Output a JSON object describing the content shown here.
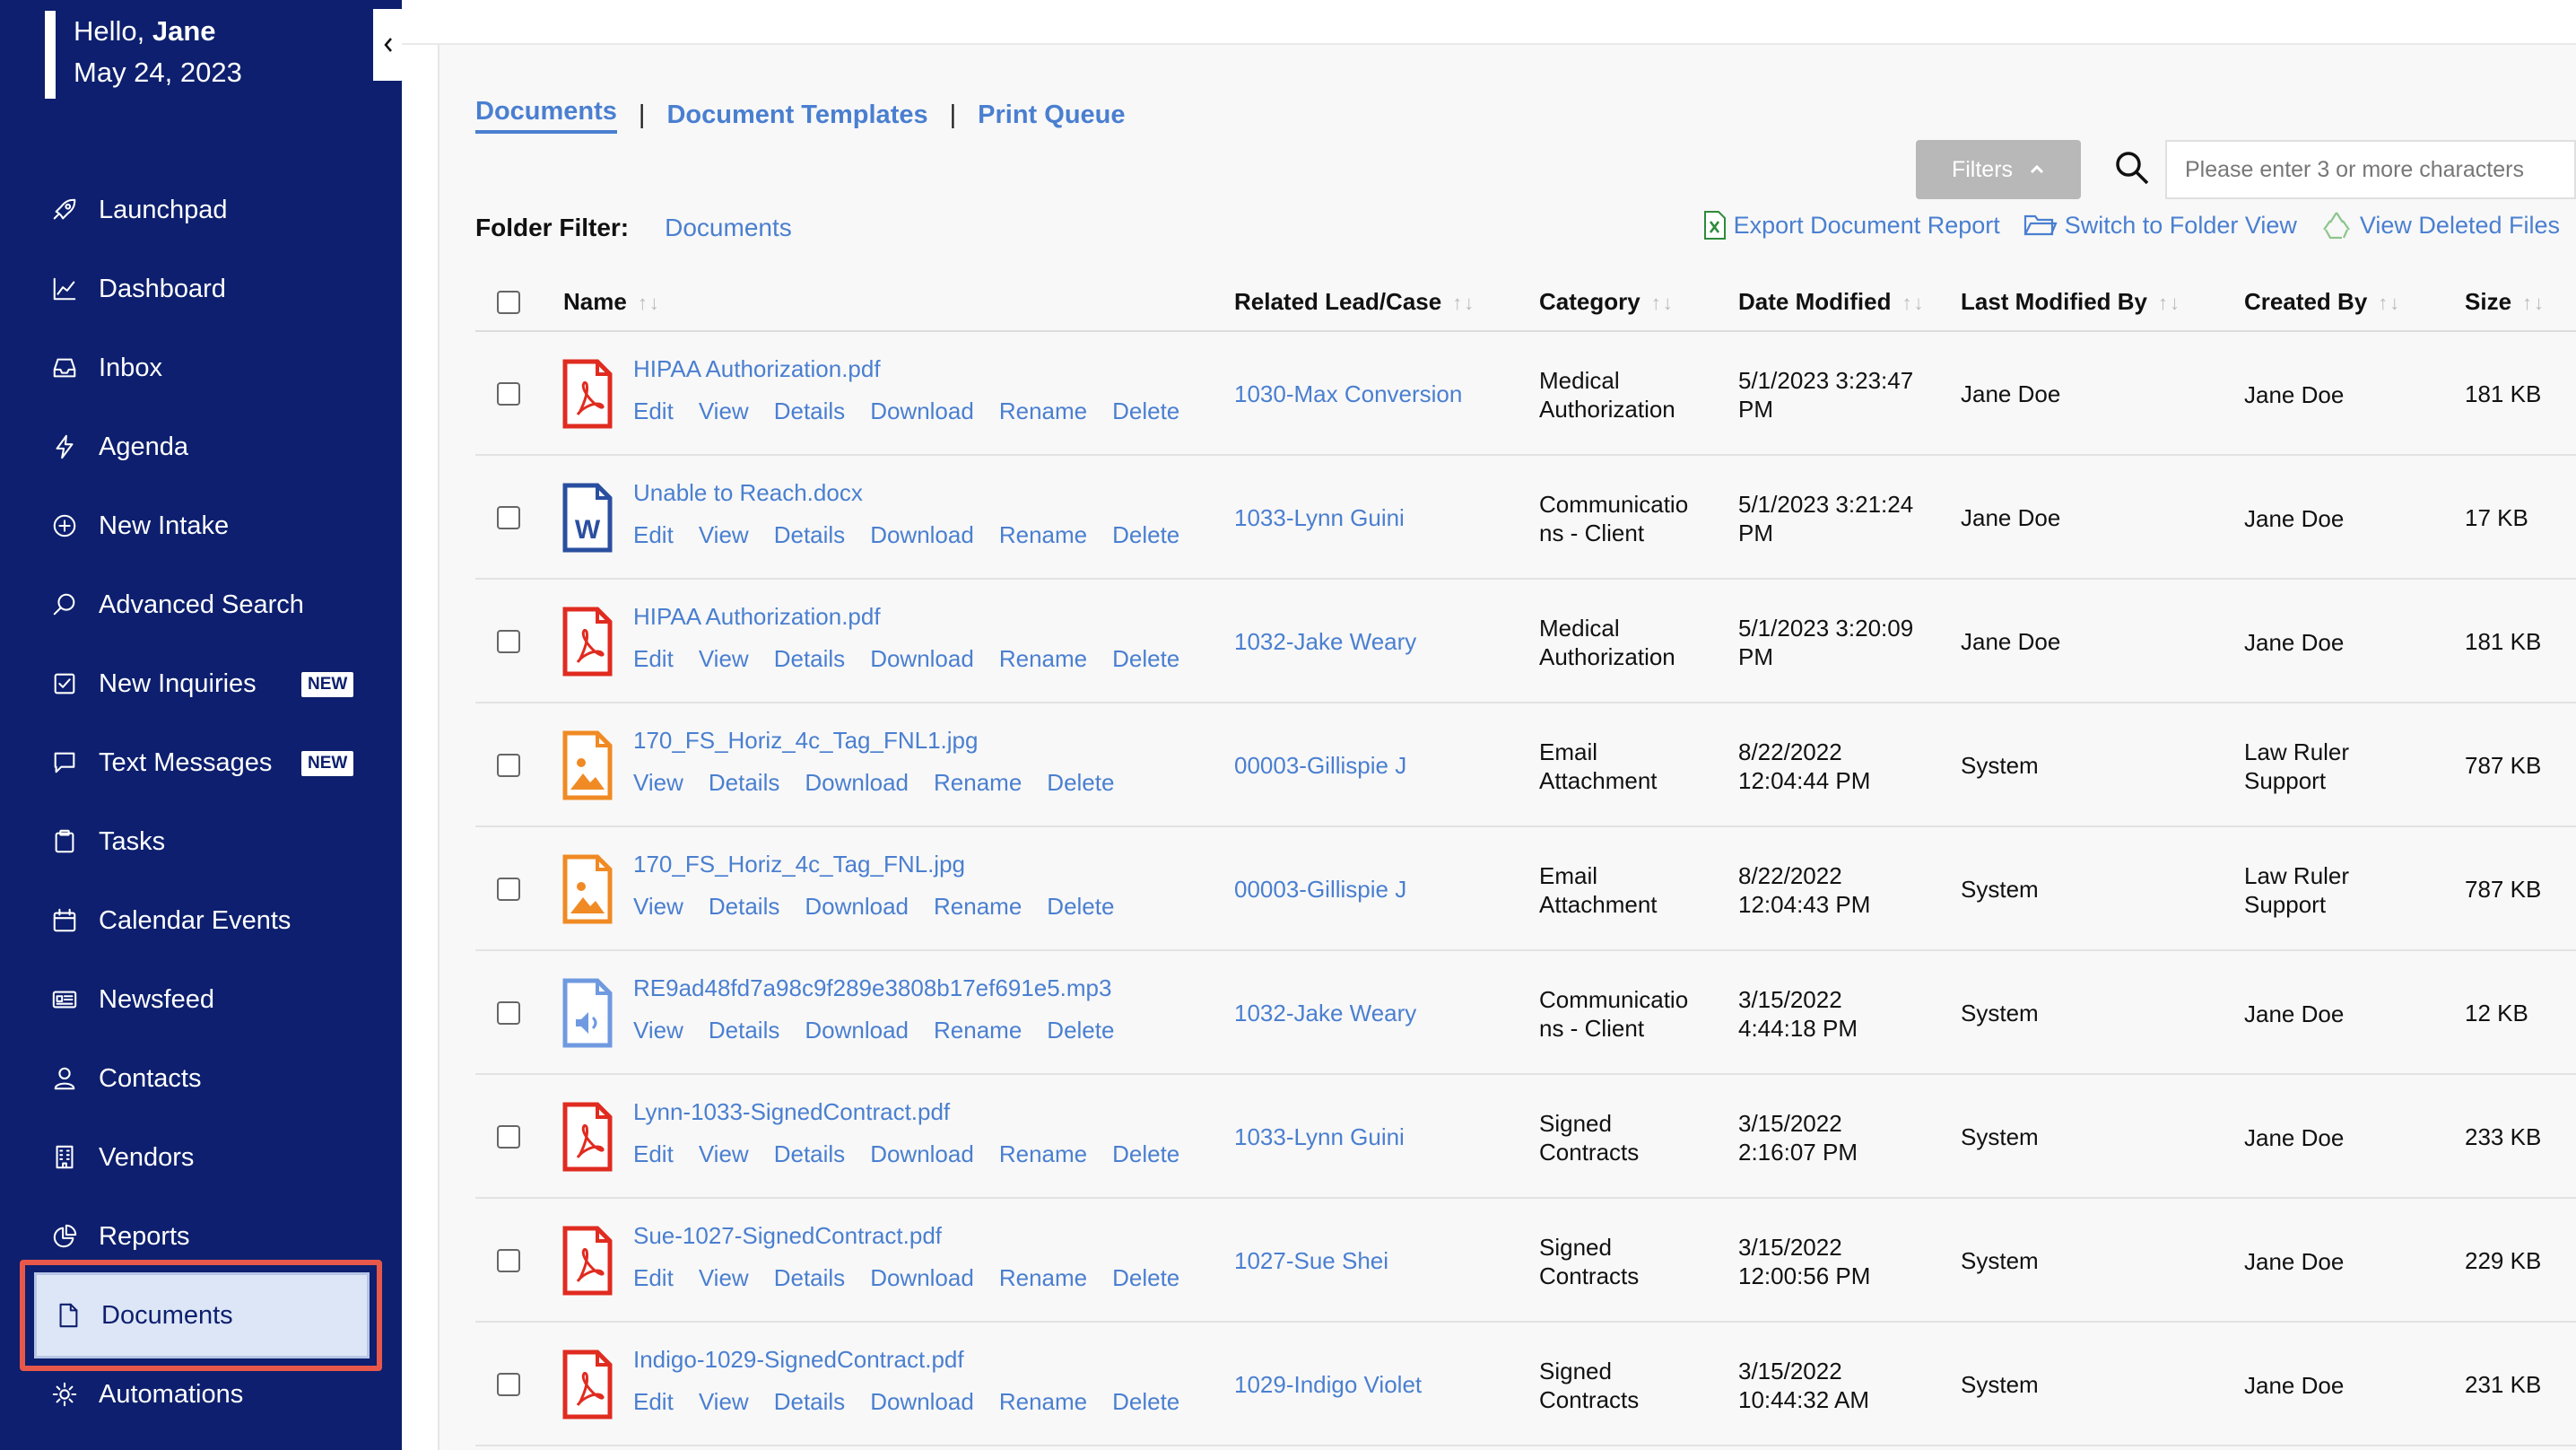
{
  "greeting": {
    "hello": "Hello,",
    "name": "Jane",
    "date": "May 24, 2023"
  },
  "sidebar": {
    "items": [
      {
        "label": "Launchpad",
        "icon": "rocket-icon"
      },
      {
        "label": "Dashboard",
        "icon": "chart-line-icon"
      },
      {
        "label": "Inbox",
        "icon": "inbox-icon"
      },
      {
        "label": "Agenda",
        "icon": "lightning-icon"
      },
      {
        "label": "New Intake",
        "icon": "plus-circle-icon"
      },
      {
        "label": "Advanced Search",
        "icon": "search-icon"
      },
      {
        "label": "New Inquiries",
        "icon": "checkbox-icon",
        "badge": "NEW"
      },
      {
        "label": "Text Messages",
        "icon": "message-icon",
        "badge": "NEW"
      },
      {
        "label": "Tasks",
        "icon": "clipboard-icon"
      },
      {
        "label": "Calendar Events",
        "icon": "calendar-icon"
      },
      {
        "label": "Newsfeed",
        "icon": "newspaper-icon"
      },
      {
        "label": "Contacts",
        "icon": "person-icon"
      },
      {
        "label": "Vendors",
        "icon": "building-icon"
      },
      {
        "label": "Reports",
        "icon": "pie-chart-icon"
      },
      {
        "label": "Documents",
        "icon": "document-icon"
      },
      {
        "label": "Automations",
        "icon": "gear-icon"
      }
    ]
  },
  "tabs": [
    "Documents",
    "Document Templates",
    "Print Queue"
  ],
  "filters_label": "Filters",
  "search_placeholder": "Please enter 3 or more characters",
  "folder_filter": {
    "label": "Folder Filter:",
    "value": "Documents"
  },
  "actions": {
    "export": "Export Document Report",
    "switch": "Switch to Folder View",
    "deleted": "View Deleted Files"
  },
  "columns": [
    "Name",
    "Related Lead/Case",
    "Category",
    "Date Modified",
    "Last Modified By",
    "Created By",
    "Size"
  ],
  "rows": [
    {
      "name": "HIPAA Authorization.pdf",
      "type": "pdf",
      "links": [
        "Edit",
        "View",
        "Details",
        "Download",
        "Rename",
        "Delete"
      ],
      "case": "1030-Max Conversion",
      "category": [
        "Medical",
        "Authorization"
      ],
      "date": [
        "5/1/2023 3:23:47",
        "PM"
      ],
      "modby": "Jane Doe",
      "created": [
        "Jane Doe"
      ],
      "size": "181 KB"
    },
    {
      "name": "Unable to Reach.docx",
      "type": "word",
      "links": [
        "Edit",
        "View",
        "Details",
        "Download",
        "Rename",
        "Delete"
      ],
      "case": "1033-Lynn Guini",
      "category": [
        "Communicatio",
        "ns - Client"
      ],
      "date": [
        "5/1/2023 3:21:24",
        "PM"
      ],
      "modby": "Jane Doe",
      "created": [
        "Jane Doe"
      ],
      "size": "17 KB"
    },
    {
      "name": "HIPAA Authorization.pdf",
      "type": "pdf",
      "links": [
        "Edit",
        "View",
        "Details",
        "Download",
        "Rename",
        "Delete"
      ],
      "case": "1032-Jake Weary",
      "category": [
        "Medical",
        "Authorization"
      ],
      "date": [
        "5/1/2023 3:20:09",
        "PM"
      ],
      "modby": "Jane Doe",
      "created": [
        "Jane Doe"
      ],
      "size": "181 KB"
    },
    {
      "name": "170_FS_Horiz_4c_Tag_FNL1.jpg",
      "type": "image",
      "links": [
        "View",
        "Details",
        "Download",
        "Rename",
        "Delete"
      ],
      "case": "00003-Gillispie J",
      "category": [
        "Email",
        "Attachment"
      ],
      "date": [
        "8/22/2022",
        "12:04:44 PM"
      ],
      "modby": "System",
      "created": [
        "Law Ruler",
        "Support"
      ],
      "size": "787 KB"
    },
    {
      "name": "170_FS_Horiz_4c_Tag_FNL.jpg",
      "type": "image",
      "links": [
        "View",
        "Details",
        "Download",
        "Rename",
        "Delete"
      ],
      "case": "00003-Gillispie J",
      "category": [
        "Email",
        "Attachment"
      ],
      "date": [
        "8/22/2022",
        "12:04:43 PM"
      ],
      "modby": "System",
      "created": [
        "Law Ruler",
        "Support"
      ],
      "size": "787 KB"
    },
    {
      "name": "RE9ad48fd7a98c9f289e3808b17ef691e5.mp3",
      "type": "audio",
      "links": [
        "View",
        "Details",
        "Download",
        "Rename",
        "Delete"
      ],
      "case": "1032-Jake Weary",
      "category": [
        "Communicatio",
        "ns - Client"
      ],
      "date": [
        "3/15/2022",
        "4:44:18 PM"
      ],
      "modby": "System",
      "created": [
        "Jane Doe"
      ],
      "size": "12 KB"
    },
    {
      "name": "Lynn-1033-SignedContract.pdf",
      "type": "pdf",
      "links": [
        "Edit",
        "View",
        "Details",
        "Download",
        "Rename",
        "Delete"
      ],
      "case": "1033-Lynn Guini",
      "category": [
        "Signed",
        "Contracts"
      ],
      "date": [
        "3/15/2022",
        "2:16:07 PM"
      ],
      "modby": "System",
      "created": [
        "Jane Doe"
      ],
      "size": "233 KB"
    },
    {
      "name": "Sue-1027-SignedContract.pdf",
      "type": "pdf",
      "links": [
        "Edit",
        "View",
        "Details",
        "Download",
        "Rename",
        "Delete"
      ],
      "case": "1027-Sue Shei",
      "category": [
        "Signed",
        "Contracts"
      ],
      "date": [
        "3/15/2022",
        "12:00:56 PM"
      ],
      "modby": "System",
      "created": [
        "Jane Doe"
      ],
      "size": "229 KB"
    },
    {
      "name": "Indigo-1029-SignedContract.pdf",
      "type": "pdf",
      "links": [
        "Edit",
        "View",
        "Details",
        "Download",
        "Rename",
        "Delete"
      ],
      "case": "1029-Indigo Violet",
      "category": [
        "Signed",
        "Contracts"
      ],
      "date": [
        "3/15/2022",
        "10:44:32 AM"
      ],
      "modby": "System",
      "created": [
        "Jane Doe"
      ],
      "size": "231 KB"
    }
  ],
  "colors": {
    "sidebar": "#0d1f6e",
    "link": "#4a7fd0",
    "pdf": "#e02b20",
    "word": "#2a4fa0",
    "image": "#f08a24",
    "audio": "#6f9ae0",
    "highlight": "#e8584a"
  }
}
